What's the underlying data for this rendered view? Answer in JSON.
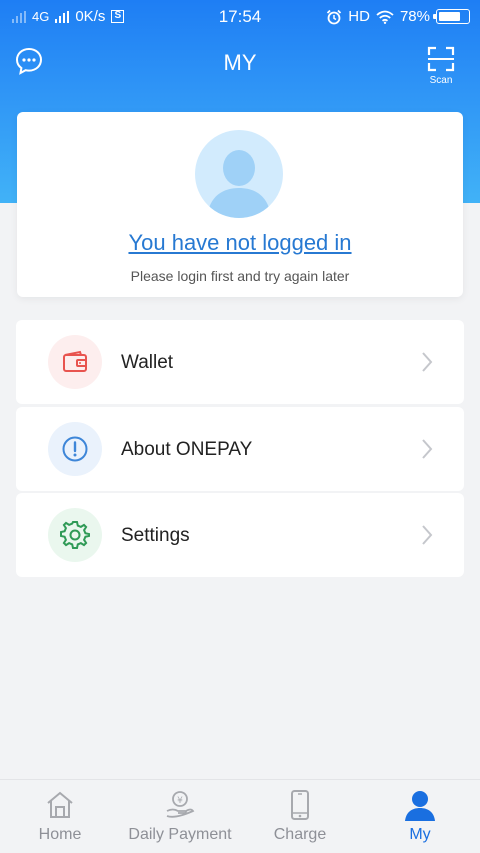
{
  "status_bar": {
    "network": "4G",
    "speed": "0K/s",
    "sim_badge": "S",
    "time": "17:54",
    "hd": "HD",
    "battery_percent": "78%",
    "battery_level": 0.78
  },
  "header": {
    "title": "MY",
    "scan_label": "Scan",
    "left_icon": "chat-bubble-icon",
    "right_icon": "scan-icon"
  },
  "profile": {
    "login_text": "You have not logged in",
    "hint_text": "Please login first and try again later"
  },
  "menu": [
    {
      "label": "Wallet",
      "icon": "wallet-icon",
      "color": "#e8544f",
      "bg": "#fdeeee"
    },
    {
      "label": "About ONEPAY",
      "icon": "info-icon",
      "color": "#3e86d8",
      "bg": "#eaf2fc"
    },
    {
      "label": "Settings",
      "icon": "gear-icon",
      "color": "#2f9a56",
      "bg": "#eaf7ee"
    }
  ],
  "tabs": [
    {
      "label": "Home",
      "icon": "home-icon",
      "active": false
    },
    {
      "label": "Daily Payment",
      "icon": "payment-hand-icon",
      "active": false
    },
    {
      "label": "Charge",
      "icon": "phone-icon",
      "active": false
    },
    {
      "label": "My",
      "icon": "user-icon",
      "active": true
    }
  ],
  "colors": {
    "primary": "#1e7ef4",
    "link": "#2779d2",
    "active_tab": "#1a6fe0",
    "inactive_tab": "#8e9097"
  }
}
